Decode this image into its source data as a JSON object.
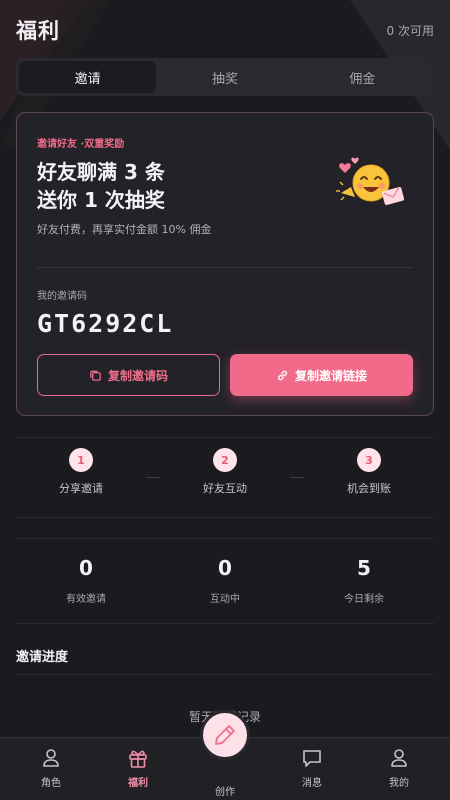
{
  "header": {
    "title": "福利",
    "available_count": "0 次可用"
  },
  "tabs": [
    {
      "label": "邀请",
      "active": true
    },
    {
      "label": "抽奖",
      "active": false
    },
    {
      "label": "佣金",
      "active": false
    }
  ],
  "invite_card": {
    "tag": "邀请好友 ·双重奖励",
    "headline_line1": "好友聊满 3 条",
    "headline_line2": "送你 1 次抽奖",
    "subtitle": "好友付费，再享实付金额 10% 佣金",
    "code_label": "我的邀请码",
    "code": "GT6292CL",
    "copy_code_label": "复制邀请码",
    "copy_link_label": "复制邀请链接",
    "emoji_icon": "party-face-emoji"
  },
  "steps": [
    {
      "num": "1",
      "label": "分享邀请"
    },
    {
      "num": "2",
      "label": "好友互动"
    },
    {
      "num": "3",
      "label": "机会到账"
    }
  ],
  "stats": [
    {
      "value": "0",
      "label": "有效邀请"
    },
    {
      "value": "0",
      "label": "互动中"
    },
    {
      "value": "5",
      "label": "今日剩余"
    }
  ],
  "progress": {
    "title": "邀请进度",
    "empty_text": "暂无邀请记录"
  },
  "nav": {
    "items": [
      {
        "label": "角色",
        "icon": "person-icon"
      },
      {
        "label": "福利",
        "icon": "gift-icon",
        "active": true
      },
      {
        "label": "创作",
        "icon": "pen-icon"
      },
      {
        "label": "消息",
        "icon": "message-icon"
      },
      {
        "label": "我的",
        "icon": "user-icon"
      }
    ]
  },
  "colors": {
    "accent": "#f26a89",
    "background": "#1b1a1f",
    "card": "#232228"
  }
}
